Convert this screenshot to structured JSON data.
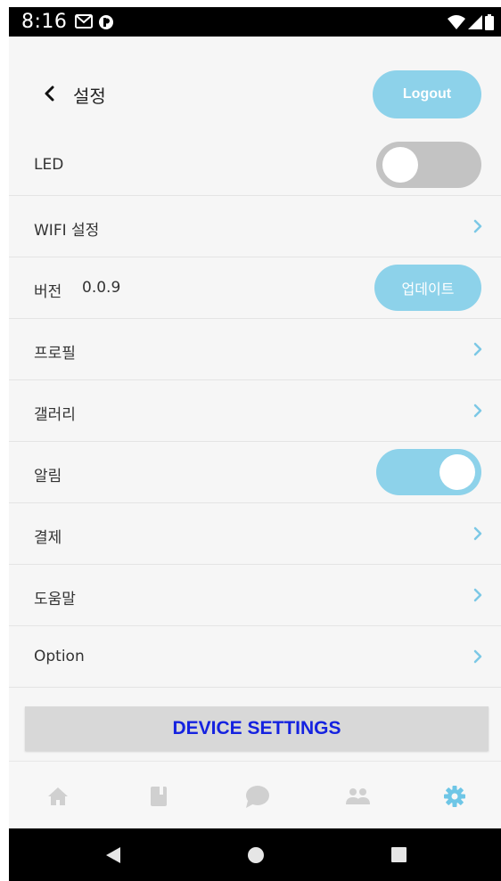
{
  "status_bar": {
    "time": "8:16"
  },
  "header": {
    "title": "설정",
    "logout_label": "Logout"
  },
  "rows": [
    {
      "label": "LED",
      "control": "toggle",
      "state": "off"
    },
    {
      "label": "WIFI 설정",
      "control": "chevron"
    },
    {
      "label": "버전",
      "version": "0.0.9",
      "control": "button",
      "button_label": "업데이트"
    },
    {
      "label": "프로필",
      "control": "chevron"
    },
    {
      "label": "갤러리",
      "control": "chevron"
    },
    {
      "label": "알림",
      "control": "toggle",
      "state": "on"
    },
    {
      "label": "결제",
      "control": "chevron"
    },
    {
      "label": "도움말",
      "control": "chevron"
    },
    {
      "label": "Option",
      "control": "chevron"
    }
  ],
  "device_settings_label": "DEVICE SETTINGS",
  "tabs": [
    {
      "icon": "home-icon",
      "active": false
    },
    {
      "icon": "book-icon",
      "active": false
    },
    {
      "icon": "chat-icon",
      "active": false
    },
    {
      "icon": "people-icon",
      "active": false
    },
    {
      "icon": "gear-icon",
      "active": true
    }
  ],
  "colors": {
    "accent": "#8dd2ea",
    "toggle_off": "#c3c3c3",
    "device_button_text": "#1522e0",
    "tab_inactive": "#d0d0d0",
    "tab_active": "#6ec6e6"
  }
}
